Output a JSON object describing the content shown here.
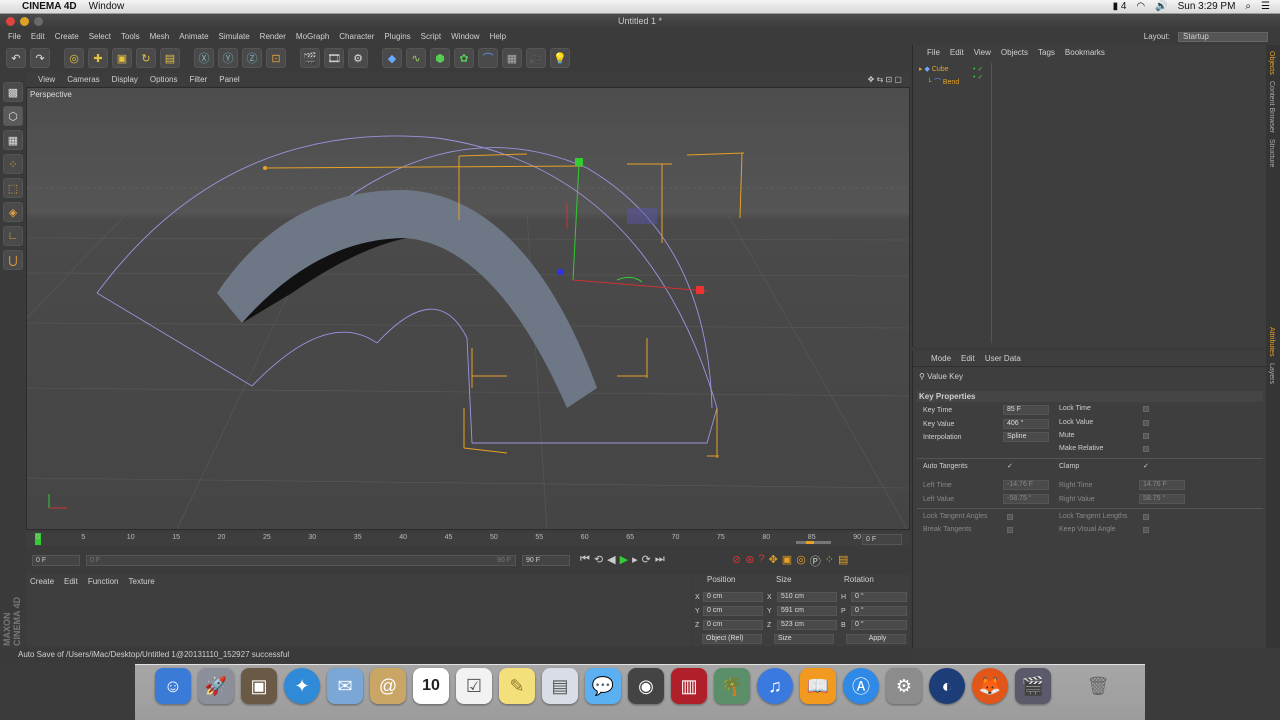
{
  "mac_menubar": {
    "app_name": "CINEMA 4D",
    "menu": [
      "Window"
    ],
    "battery": "4",
    "clock": "Sun 3:29 PM"
  },
  "window": {
    "title": "Untitled 1 *"
  },
  "menus": [
    "File",
    "Edit",
    "Create",
    "Select",
    "Tools",
    "Mesh",
    "Animate",
    "Simulate",
    "Render",
    "MoGraph",
    "Character",
    "Plugins",
    "Script",
    "Window",
    "Help"
  ],
  "layout": {
    "label": "Layout:",
    "value": "Startup"
  },
  "viewport": {
    "menu": [
      "View",
      "Cameras",
      "Display",
      "Options",
      "Filter",
      "Panel"
    ],
    "label": "Perspective"
  },
  "timeline": {
    "ticks": [
      "0",
      "5",
      "10",
      "15",
      "20",
      "25",
      "30",
      "35",
      "40",
      "45",
      "50",
      "55",
      "60",
      "65",
      "70",
      "75",
      "80",
      "85",
      "90"
    ],
    "current": "0 F",
    "start": "0 F",
    "range_start": "0 F",
    "range_end": "90 F",
    "end": "90 F"
  },
  "material_panel": {
    "menu": [
      "Create",
      "Edit",
      "Function",
      "Texture"
    ]
  },
  "coordinates": {
    "headers": [
      "Position",
      "Size",
      "Rotation"
    ],
    "rows": [
      {
        "axis": "X",
        "pos": "0 cm",
        "size_axis": "X",
        "size": "510 cm",
        "rot_axis": "H",
        "rot": "0 °"
      },
      {
        "axis": "Y",
        "pos": "0 cm",
        "size_axis": "Y",
        "size": "591 cm",
        "rot_axis": "P",
        "rot": "0 °"
      },
      {
        "axis": "Z",
        "pos": "0 cm",
        "size_axis": "Z",
        "size": "523 cm",
        "rot_axis": "B",
        "rot": "0 °"
      }
    ],
    "mode": "Object (Rel)",
    "size_mode": "Size",
    "apply": "Apply"
  },
  "status": "Auto Save of /Users/iMac/Desktop/Untitled 1@20131110_152927 successful",
  "object_manager": {
    "menu": [
      "File",
      "Edit",
      "View",
      "Objects",
      "Tags",
      "Bookmarks"
    ],
    "objects": [
      "Cube",
      "Bend"
    ]
  },
  "attributes": {
    "menu": [
      "Mode",
      "Edit",
      "User Data"
    ],
    "title": "Value Key",
    "section": "Key Properties",
    "key_time_label": "Key Time",
    "key_time": "85 F",
    "key_value_label": "Key Value",
    "key_value": "406 °",
    "interp_label": "Interpolation",
    "interp": "Spline",
    "lock_time": "Lock Time",
    "lock_value": "Lock Value",
    "mute": "Mute",
    "make_relative": "Make Relative",
    "auto_tangents": "Auto Tangents",
    "clamp": "Clamp",
    "left_time_label": "Left Time",
    "left_time": "-14.76 F",
    "right_time_label": "Right Time",
    "right_time": "14.76 F",
    "left_value_label": "Left Value",
    "left_value": "-58.75 °",
    "right_value_label": "Right Value",
    "right_value": "58.75 °",
    "lock_tangent_angles": "Lock Tangent Angles",
    "lock_tangent_lengths": "Lock Tangent Lengths",
    "break_tangents": "Break Tangents",
    "keep_visual_angle": "Keep Visual Angle"
  },
  "side_tabs": [
    "Objects",
    "Content Browser",
    "Structure"
  ],
  "side_tabs2": [
    "Attributes",
    "Layers"
  ],
  "dock_icons": [
    "finder-icon",
    "launchpad-icon",
    "photos-icon",
    "safari-icon",
    "mail-icon",
    "contacts-icon",
    "calendar-icon",
    "reminders-icon",
    "notes-icon",
    "preview-icon",
    "messages-icon",
    "facetime-icon",
    "photobooth-icon",
    "iphoto-icon",
    "itunes-icon",
    "ibooks-icon",
    "appstore-icon",
    "preferences-icon",
    "cinema4d-icon",
    "firefox-icon",
    "imovie-icon",
    "trash-icon"
  ],
  "dock_date": "10",
  "logo": "MAXON CINEMA 4D"
}
